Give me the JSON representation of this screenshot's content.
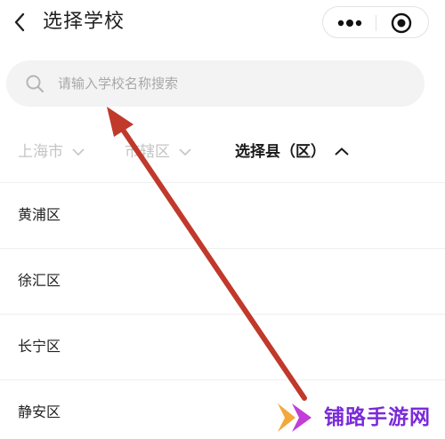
{
  "header": {
    "title": "选择学校",
    "icons": {
      "back": "chevron-left-icon",
      "more": "more-dots-icon",
      "target": "target-circle-icon"
    }
  },
  "search": {
    "placeholder": "请输入学校名称搜索",
    "value": "",
    "icon": "search-icon"
  },
  "region_tabs": [
    {
      "label": "上海市",
      "state": "inactive",
      "icon": "chevron-down-icon"
    },
    {
      "label": "市辖区",
      "state": "inactive",
      "icon": "chevron-down-icon"
    },
    {
      "label": "选择县（区）",
      "state": "active",
      "icon": "chevron-up-icon"
    }
  ],
  "districts": [
    {
      "label": "黄浦区"
    },
    {
      "label": "徐汇区"
    },
    {
      "label": "长宁区"
    },
    {
      "label": "静安区"
    }
  ],
  "annotation": {
    "color": "#c0392b",
    "points_to": "search-input"
  },
  "watermark": {
    "text": "铺路手游网",
    "color": "#7a2bd8"
  },
  "colors": {
    "active_text": "#1a1a1a",
    "inactive_text": "#c4c4c4",
    "search_bg": "#f3f3f3"
  }
}
